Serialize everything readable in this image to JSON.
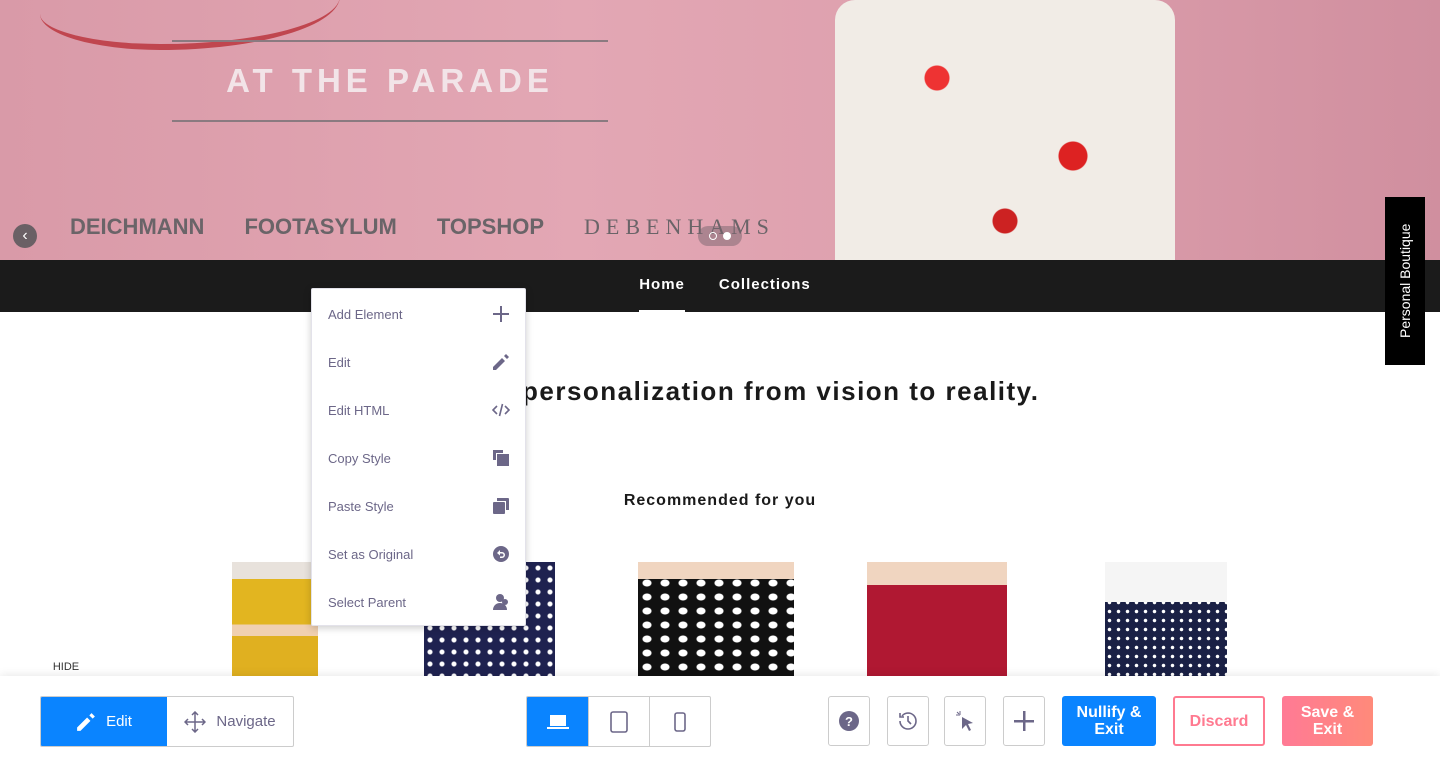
{
  "hero": {
    "tagline": "AT THE PARADE",
    "brands": [
      "DEICHMANN",
      "FOOTASYLUM",
      "TOPSHOP",
      "DEBENHAMS"
    ],
    "slide_count": 2,
    "active_slide": 2
  },
  "nav": {
    "items": [
      {
        "label": "Home",
        "active": true
      },
      {
        "label": "Collections",
        "active": false
      }
    ]
  },
  "side_tab": "Personal Boutique",
  "headline": "personalization from vision to reality.",
  "recommended": "Recommended for you",
  "context_menu": {
    "items": [
      {
        "label": "Add Element",
        "icon": "plus-icon"
      },
      {
        "label": "Edit",
        "icon": "pencil-icon"
      },
      {
        "label": "Edit HTML",
        "icon": "code-icon"
      },
      {
        "label": "Copy Style",
        "icon": "copy-style-icon"
      },
      {
        "label": "Paste Style",
        "icon": "paste-style-icon"
      },
      {
        "label": "Set as Original",
        "icon": "undo-icon"
      },
      {
        "label": "Select Parent",
        "icon": "parent-icon"
      }
    ]
  },
  "toolbar": {
    "hide": "HIDE",
    "edit": "Edit",
    "navigate": "Navigate",
    "nullify": "Nullify & Exit",
    "discard": "Discard",
    "save": "Save & Exit",
    "mode": "Edit",
    "device": "desktop"
  },
  "colors": {
    "accent": "#0a84ff",
    "danger": "#ff7a90",
    "menu_text": "#6c6788"
  }
}
